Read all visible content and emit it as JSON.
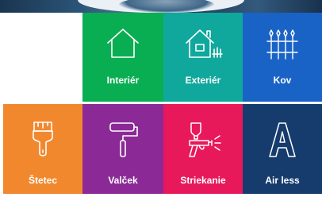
{
  "tiles": [
    {
      "id": "interier",
      "label": "Interiér",
      "icon": "house-icon",
      "color": "#0aae52"
    },
    {
      "id": "exterier",
      "label": "Exteriér",
      "icon": "house-fence-icon",
      "color": "#10a89c"
    },
    {
      "id": "kov",
      "label": "Kov",
      "icon": "metal-fence-icon",
      "color": "#1a63c6"
    },
    {
      "id": "stetec",
      "label": "Štetec",
      "icon": "paint-brush-icon",
      "color": "#f2882e"
    },
    {
      "id": "valcek",
      "label": "Valček",
      "icon": "paint-roller-icon",
      "color": "#8b2a97"
    },
    {
      "id": "striekanie",
      "label": "Striekanie",
      "icon": "spray-gun-icon",
      "color": "#e7195a"
    },
    {
      "id": "airless",
      "label": "Air less",
      "icon": "airless-a-icon",
      "color": "#153c6d"
    }
  ]
}
